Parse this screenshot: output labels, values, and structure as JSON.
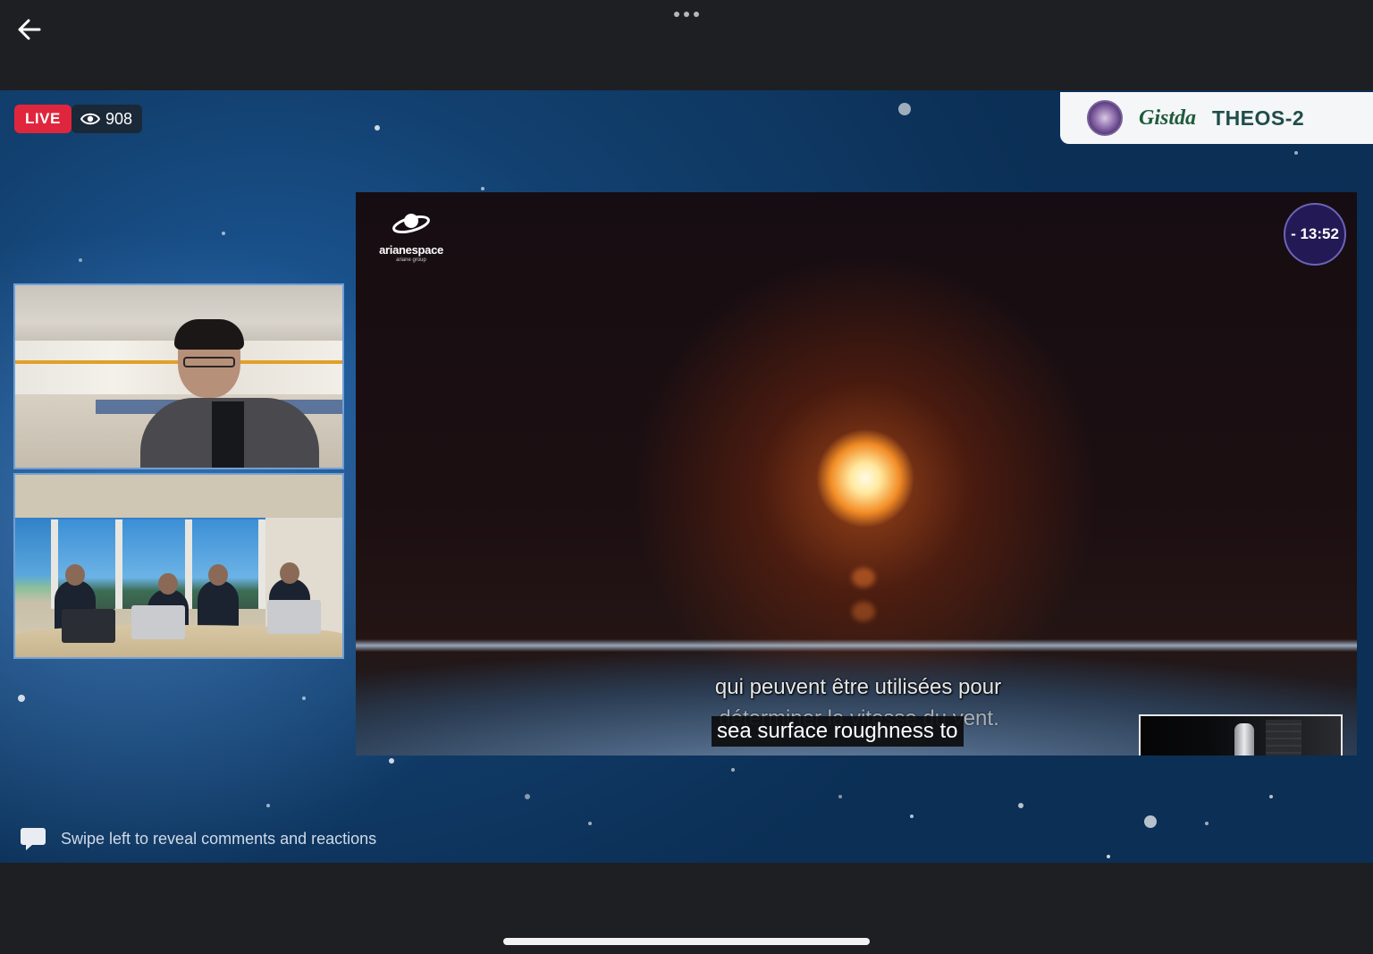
{
  "header": {
    "back_icon": "arrow-left-icon",
    "more_icon": "more-dots-icon"
  },
  "stream": {
    "live_label": "LIVE",
    "viewer_count": "908",
    "viewer_icon": "eye-icon",
    "sponsor": {
      "seal_icon": "agency-seal-icon",
      "gistda": "Gistda",
      "theos": "THEOS-2"
    },
    "main_video": {
      "broadcaster_logo": "arianespace",
      "broadcaster_sub": "ariane group",
      "countdown": "- 13:52",
      "subtitle_fr_line1": "qui peuvent être utilisées pour",
      "subtitle_fr_line2": "déterminer la vitesse du vent.",
      "subtitle_en": "sea surface roughness to"
    }
  },
  "comments_hint": {
    "icon": "speech-bubble-icon",
    "text": "Swipe left to reveal comments and reactions"
  },
  "colors": {
    "live_red": "#e0263c",
    "background": "#1e1f22",
    "countdown_bg": "#231a55"
  }
}
